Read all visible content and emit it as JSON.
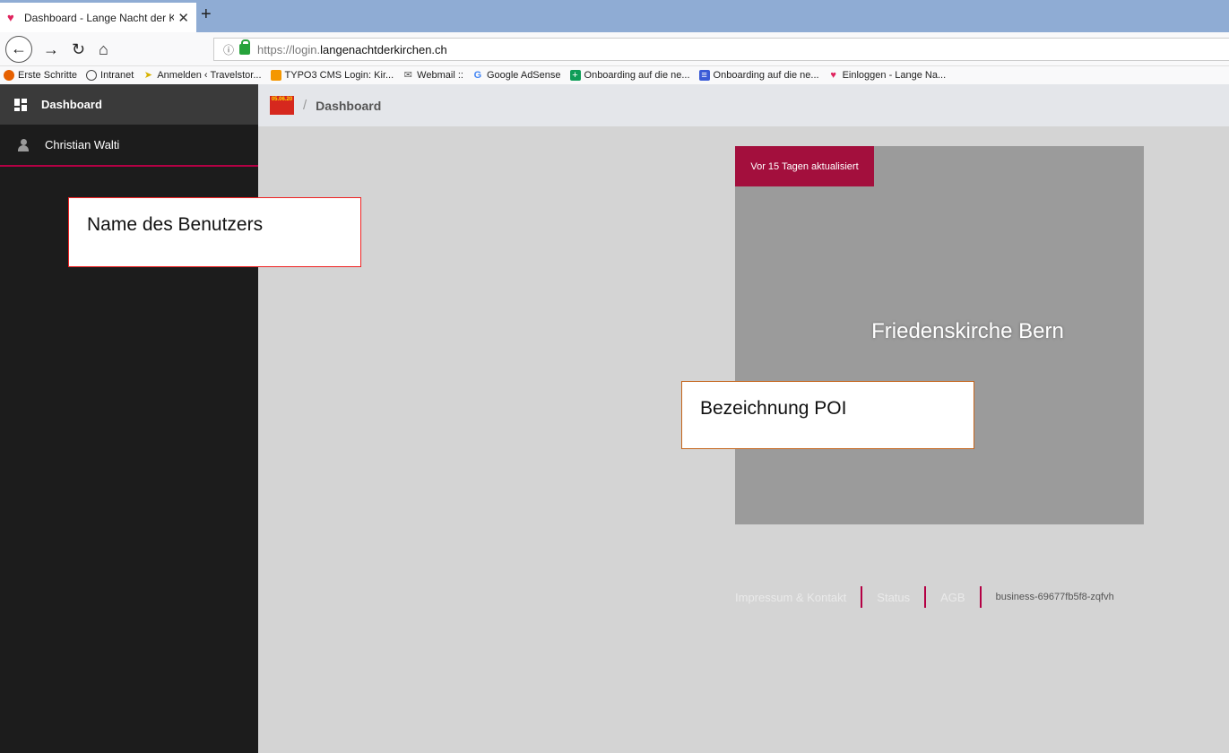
{
  "browser": {
    "tab_title": "Dashboard - Lange Nacht der K",
    "new_tab": "+",
    "close": "✕",
    "url_protocol": "https://login.",
    "url_host": "langenachtderkirchen.ch",
    "bookmarks": [
      {
        "label": "Erste Schritte",
        "icon": "firefox-icon",
        "color": "#e66000"
      },
      {
        "label": "Intranet",
        "icon": "globe-icon",
        "color": "#444444"
      },
      {
        "label": "Anmelden ‹ Travelstor...",
        "icon": "leaf-icon",
        "color": "#d8b200"
      },
      {
        "label": "TYPO3 CMS Login: Kir...",
        "icon": "typo3-icon",
        "color": "#f49700"
      },
      {
        "label": "Webmail ::",
        "icon": "mail-icon",
        "color": "#555555"
      },
      {
        "label": "Google AdSense",
        "icon": "google-icon",
        "color": "#4285f4"
      },
      {
        "label": "Onboarding auf die ne...",
        "icon": "sheets-plus-icon",
        "color": "#0f9d58"
      },
      {
        "label": "Onboarding auf die ne...",
        "icon": "list-icon",
        "color": "#3b5bd6"
      },
      {
        "label": "Einloggen - Lange Na...",
        "icon": "heart-icon",
        "color": "#e0245e"
      }
    ]
  },
  "sidebar": {
    "dashboard_label": "Dashboard",
    "user_name": "Christian Walti"
  },
  "topbar": {
    "logo_text": "05.06.20",
    "breadcrumb_sep": "/",
    "breadcrumb": "Dashboard"
  },
  "poi": {
    "badge": "Vor 15 Tagen aktualisiert",
    "title": "Friedenskirche Bern"
  },
  "footer": {
    "links": [
      "Impressum & Kontakt",
      "Status",
      "AGB"
    ],
    "version": "business-69677fb5f8-zqfvh"
  },
  "annotations": {
    "user": "Name des Benutzers",
    "poi": "Bezeichnung POI"
  },
  "colors": {
    "accent": "#a30f3d",
    "sidebar": "#1c1c1c",
    "card": "#9b9b9b"
  }
}
